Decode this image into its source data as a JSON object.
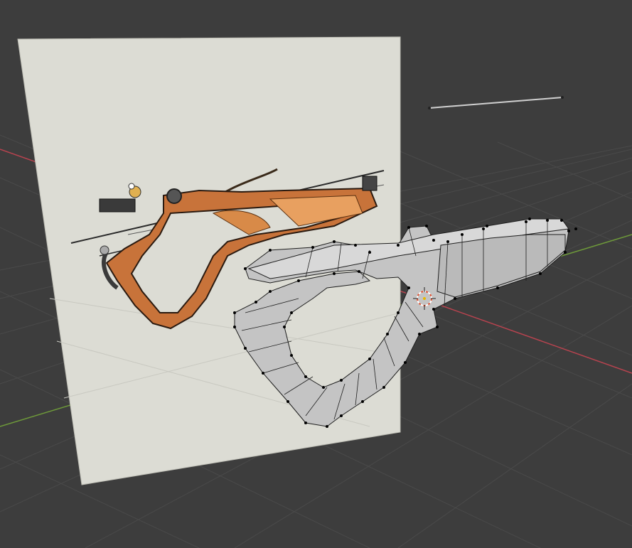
{
  "viewport": {
    "background_color": "#3d3d3d",
    "grid_color": "#4a4a4a",
    "x_axis_color": "#b8434f",
    "y_axis_color": "#6e9a3a"
  },
  "reference_image": {
    "icon": "crossbow-reference-image",
    "paper_color": "#dcdcd4",
    "wood_color": "#c8733a",
    "metal_color": "#3a3a3a"
  },
  "mesh": {
    "icon": "crossbow-wireframe-mesh",
    "face_color": "#c8c8c8",
    "edge_color": "#1e1e1e",
    "vertex_color": "#000000"
  },
  "cursor_3d": {
    "icon": "3d-cursor-icon",
    "color": "#e05030"
  },
  "empty_line": {
    "icon": "empty-line-object",
    "color": "#d0d0d0"
  }
}
